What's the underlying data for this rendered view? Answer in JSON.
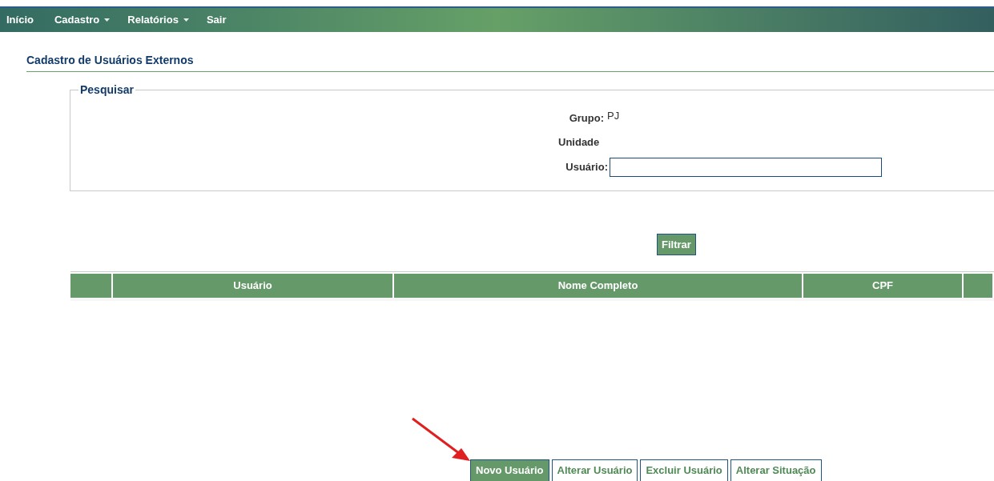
{
  "menu": [
    {
      "label": "Início",
      "has_menu": false
    },
    {
      "label": "Cadastro",
      "has_menu": true
    },
    {
      "label": "Relatórios",
      "has_menu": true
    },
    {
      "label": "Sair",
      "has_menu": false
    }
  ],
  "page_title": "Cadastro de Usuários Externos",
  "search": {
    "legend": "Pesquisar",
    "grupo_label": "Grupo:",
    "grupo_value": "PJ",
    "unidade_label": "Unidade",
    "usuario_label": "Usuário:",
    "filter_button": "Filtrar"
  },
  "table": {
    "columns": [
      "",
      "Usuário",
      "Nome Completo",
      "CPF",
      ""
    ]
  },
  "actions": [
    {
      "label": "Novo Usuário",
      "selected": true
    },
    {
      "label": "Alterar Usuário",
      "selected": false
    },
    {
      "label": "Excluir Usuário",
      "selected": false
    },
    {
      "label": "Alterar Situação",
      "selected": false
    }
  ]
}
